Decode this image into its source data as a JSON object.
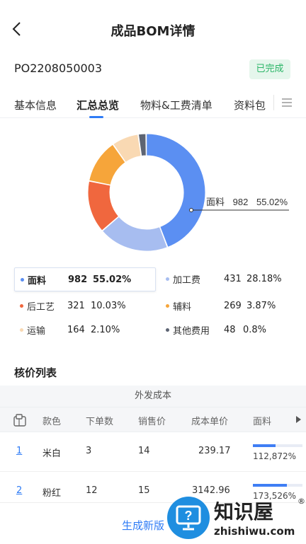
{
  "header": {
    "title": "成品BOM详情"
  },
  "order": {
    "number": "PO2208050003",
    "status": "已完成",
    "status_color": "#2bb567"
  },
  "tabs": [
    {
      "label": "基本信息",
      "active": false
    },
    {
      "label": "汇总总览",
      "active": true
    },
    {
      "label": "物料&工费清单",
      "active": false
    },
    {
      "label": "资料包",
      "active": false
    }
  ],
  "chart_data": {
    "type": "pie",
    "categories": [
      "面料",
      "加工费",
      "后工艺",
      "辅料",
      "运输",
      "其他费用"
    ],
    "values": [
      982,
      431,
      321,
      269,
      164,
      48
    ],
    "percents": [
      "55.02%",
      "28.18%",
      "10.03%",
      "3.87%",
      "2.10%",
      "0.8%"
    ],
    "colors": [
      "#5b8ff2",
      "#a7bdf0",
      "#f0673e",
      "#f6a53a",
      "#f9d9b3",
      "#5d6473"
    ],
    "callout": {
      "label": "面料",
      "value": "982",
      "percent": "55.02%"
    }
  },
  "legend": [
    {
      "name": "面料",
      "value": "982",
      "percent": "55.02%",
      "color": "#5b8ff2"
    },
    {
      "name": "加工费",
      "value": "431",
      "percent": "28.18%",
      "color": "#a7bdf0"
    },
    {
      "name": "后工艺",
      "value": "321",
      "percent": "10.03%",
      "color": "#f0673e"
    },
    {
      "name": "辅料",
      "value": "269",
      "percent": "3.87%",
      "color": "#f6a53a"
    },
    {
      "name": "运输",
      "value": "164",
      "percent": "2.10%",
      "color": "#f9d9b3"
    },
    {
      "name": "其他费用",
      "value": "48",
      "percent": "0.8%",
      "color": "#5d6473"
    }
  ],
  "pricing": {
    "title": "核价列表",
    "group_header": "外发成本",
    "columns": [
      "款色",
      "下单数",
      "销售价",
      "成本单价",
      "面料"
    ],
    "rows": [
      {
        "index": "1",
        "color": "米白",
        "qty": "3",
        "price": "14",
        "unit_cost": "239.17",
        "fabric": "112,872%",
        "fabric_progress": 0.45
      },
      {
        "index": "2",
        "color": "粉红",
        "qty": "12",
        "price": "15",
        "unit_cost": "3142.96",
        "fabric": "173,526%",
        "fabric_progress": 0.68
      }
    ]
  },
  "footer": {
    "generate_button": "生成新版"
  },
  "watermark": {
    "title": "知识屋",
    "site": "zhishiwu.com",
    "reg": "®"
  }
}
